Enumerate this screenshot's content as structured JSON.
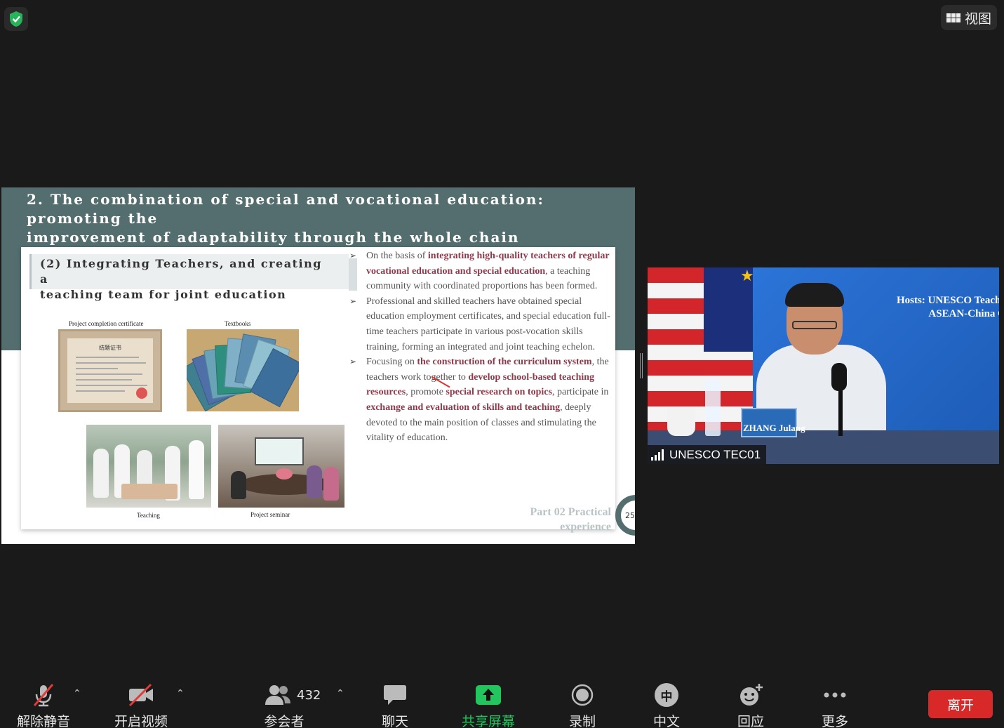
{
  "topbar": {
    "view_label": "视图"
  },
  "slide": {
    "title_line1": "2. The combination of special and vocational education: promoting the",
    "title_line2": "improvement of adaptability through the whole chain",
    "subtitle_line1": "(2) Integrating Teachers, and creating a",
    "subtitle_line2": "teaching team for joint education",
    "captions": {
      "certificate": "Project completion certificate",
      "textbooks": "Textbooks",
      "teaching": "Teaching",
      "seminar": "Project seminar"
    },
    "certificate_title": "结题证书",
    "bullet1": {
      "a": "On the basis of ",
      "b": "integrating high-quality teachers of regular vocational education and special education",
      "c": ", a teaching community with coordinated proportions has been formed."
    },
    "bullet2": "Professional and skilled teachers have obtained special education employment certificates, and special education full-time teachers participate in various post-vocation skills training, forming an integrated and joint teaching echelon.",
    "bullet3": {
      "a": "Focusing on ",
      "b": "the construction of the curriculum system",
      "c": ", the teachers work together to ",
      "d": "develop school-based teaching resources",
      "e": ", promote ",
      "f": "special research on topics",
      "g": ", participate in ",
      "h": "exchange and evaluation of skills and teaching",
      "i": ", deeply devoted to the main position of classes and stimulating the vitality of education."
    },
    "footer_line1": "Part 02  Practical",
    "footer_line2": "experience",
    "page_number": "25"
  },
  "video": {
    "hosts_line1": "Hosts: UNESCO Teache",
    "hosts_line2": "ASEAN-China C",
    "name_card": "ZHANG Julang",
    "participant_name": "UNESCO TEC01"
  },
  "toolbar": {
    "unmute": "解除静音",
    "start_video": "开启视频",
    "participants": "参会者",
    "participants_count": "432",
    "chat": "聊天",
    "share_screen": "共享屏幕",
    "record": "录制",
    "language": "中文",
    "language_icon_char": "中",
    "reactions": "回应",
    "more": "更多",
    "leave": "离开"
  },
  "colors": {
    "share_green": "#22c55e",
    "leave_red": "#d92828",
    "slide_band": "#546e70",
    "highlight": "#8e3a4b"
  }
}
